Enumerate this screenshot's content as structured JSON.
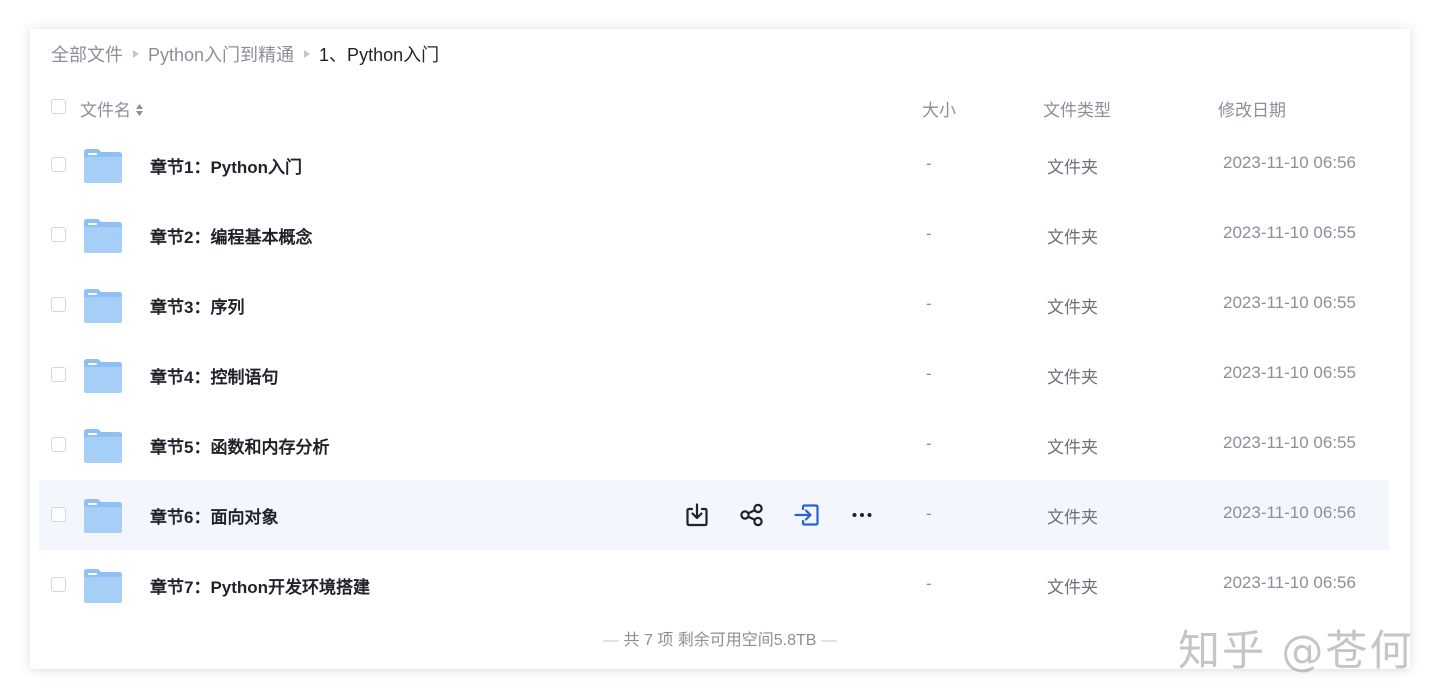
{
  "breadcrumb": {
    "items": [
      "全部文件",
      "Python入门到精通",
      "1、Python入门"
    ]
  },
  "table_header": {
    "name": "文件名",
    "size": "大小",
    "type": "文件类型",
    "date": "修改日期"
  },
  "rows": [
    {
      "name": "章节1：Python入门",
      "size": "-",
      "type": "文件夹",
      "date": "2023-11-10 06:56"
    },
    {
      "name": "章节2：编程基本概念",
      "size": "-",
      "type": "文件夹",
      "date": "2023-11-10 06:55"
    },
    {
      "name": "章节3：序列",
      "size": "-",
      "type": "文件夹",
      "date": "2023-11-10 06:55"
    },
    {
      "name": "章节4：控制语句",
      "size": "-",
      "type": "文件夹",
      "date": "2023-11-10 06:55"
    },
    {
      "name": "章节5：函数和内存分析",
      "size": "-",
      "type": "文件夹",
      "date": "2023-11-10 06:55"
    },
    {
      "name": "章节6：面向对象",
      "size": "-",
      "type": "文件夹",
      "date": "2023-11-10 06:56"
    },
    {
      "name": "章节7：Python开发环境搭建",
      "size": "-",
      "type": "文件夹",
      "date": "2023-11-10 06:56"
    }
  ],
  "hover_actions": [
    "download-icon",
    "share-icon",
    "move-icon",
    "more-icon"
  ],
  "footer": {
    "dash_left": "—",
    "text": "共 7 项 剩余可用空间5.8TB",
    "dash_right": "—"
  },
  "watermark": "知乎 @苍何",
  "colors": {
    "folder": "#8ec0f5",
    "accent": "#2563d6",
    "hover_row": "#f3f7fd"
  }
}
